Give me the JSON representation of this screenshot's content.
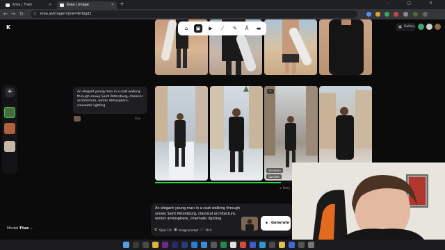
{
  "browser": {
    "tabs": [
      {
        "label": "Krea | Train"
      },
      {
        "label": "Krea | Image"
      }
    ],
    "new_tab": "+",
    "url": "krea.ai/image?style=9h6qjd2",
    "window_controls": "– ▢ ✕"
  },
  "app": {
    "logo": "K",
    "toolbar_tools": [
      "home-icon",
      "image-icon",
      "video-icon",
      "enhance-icon",
      "edit-icon",
      "train-icon",
      "folder-icon"
    ],
    "active_tool": "image-icon",
    "gallery_label": "Gallery",
    "add_label": "+"
  },
  "generation": {
    "prompt": "An elegant young man in a coat walking through snowy Saint Petersburg, classical architecture, winter atmosphere, cinematic lighting",
    "meta": "Flux",
    "progress": 0.58,
    "retry_label": "Retry",
    "hover_actions": [
      "Variation",
      "Upscale"
    ]
  },
  "composer": {
    "prompt": "An elegant young man in a coat walking through snowy Saint Petersburg, classical architecture, winter atmosphere, cinematic lighting",
    "style_chip": "Style 1/5",
    "image_prompt_chip": "Image prompt",
    "aspect_chip": "16:9",
    "generate_label": "Generate"
  },
  "model": {
    "label": "Model",
    "value": "Flux"
  },
  "colors": {
    "accent_green": "#2bd44a",
    "background": "#0b0b0c",
    "panel": "#1c1c1e"
  }
}
